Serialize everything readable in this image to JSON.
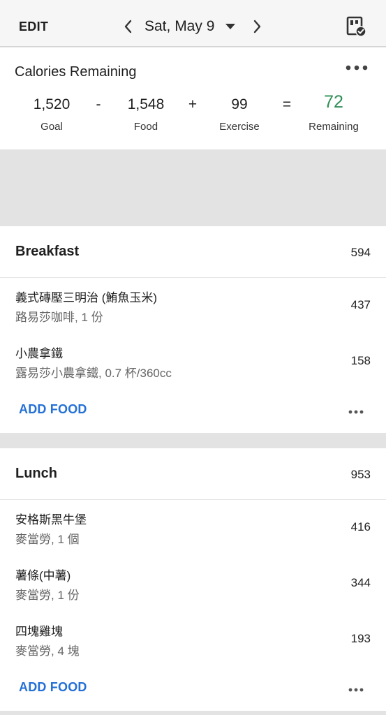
{
  "header": {
    "edit_label": "EDIT",
    "date": "Sat, May 9",
    "prev_icon": "chevron-left-icon",
    "next_icon": "chevron-right-icon",
    "caret_icon": "caret-down-icon",
    "action_icon": "calendar-check-icon"
  },
  "summary": {
    "title": "Calories Remaining",
    "goal": "1,520",
    "goal_label": "Goal",
    "minus": "-",
    "food": "1,548",
    "food_label": "Food",
    "plus": "+",
    "exercise": "99",
    "exercise_label": "Exercise",
    "equals": "=",
    "remaining": "72",
    "remaining_label": "Remaining",
    "remaining_color": "#2f8f57"
  },
  "meals": [
    {
      "name": "Breakfast",
      "total": "594",
      "add_label": "ADD FOOD",
      "entries": [
        {
          "name": "義式磚壓三明治 (鮪魚玉米)",
          "detail": "路易莎咖啡, 1 份",
          "calories": "437"
        },
        {
          "name": "小農拿鐵",
          "detail": "露易莎小農拿鐵, 0.7 杯/360cc",
          "calories": "158"
        }
      ]
    },
    {
      "name": "Lunch",
      "total": "953",
      "add_label": "ADD FOOD",
      "entries": [
        {
          "name": "安格斯黑牛堡",
          "detail": "麥當勞, 1 個",
          "calories": "416"
        },
        {
          "name": "薯條(中薯)",
          "detail": "麥當勞, 1 份",
          "calories": "344"
        },
        {
          "name": "四塊雞塊",
          "detail": "麥當勞, 4 塊",
          "calories": "193"
        }
      ]
    }
  ],
  "colors": {
    "accent_blue": "#2470d6",
    "remaining_green": "#2f8f57",
    "divider_gray": "#e3e3e3"
  }
}
